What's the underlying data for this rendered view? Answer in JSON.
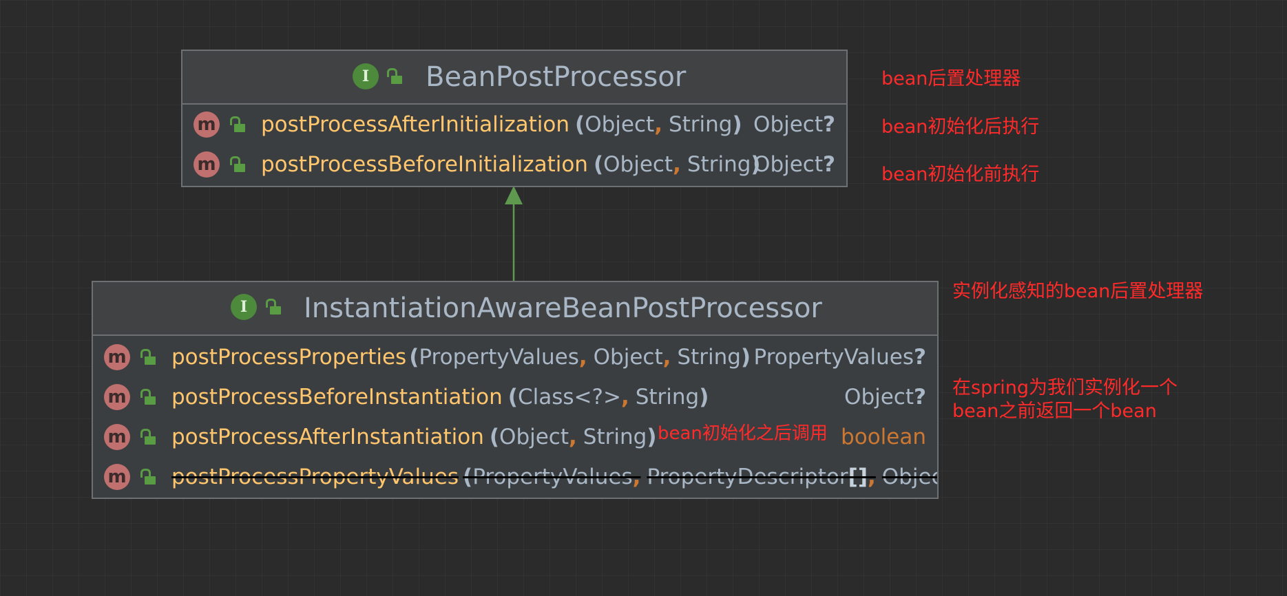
{
  "upper": {
    "badge": "I",
    "name": "BeanPostProcessor",
    "methods": [
      {
        "name": "postProcessAfterInitialization",
        "open": "(",
        "p1": "Object",
        "sep": ",",
        "p2": "String",
        "close": ")",
        "ret": "Object",
        "q": "?"
      },
      {
        "name": "postProcessBeforeInitialization",
        "open": "(",
        "p1": "Object",
        "sep": ",",
        "p2": "String",
        "close": ")",
        "ret": "Object",
        "q": "?"
      }
    ]
  },
  "lower": {
    "badge": "I",
    "name": "InstantiationAwareBeanPostProcessor",
    "methods": [
      {
        "name": "postProcessProperties",
        "open": "(",
        "p1": "PropertyValues",
        "sep1": ",",
        "p2": "Object",
        "sep2": ",",
        "p3": "String",
        "close": ")",
        "ret": "PropertyValues",
        "q": "?"
      },
      {
        "name": "postProcessBeforeInstantiation",
        "open": "(",
        "p1": "Class<?>",
        "sep": ",",
        "p2": "String",
        "close": ")",
        "ret": "Object",
        "q": "?"
      },
      {
        "name": "postProcessAfterInstantiation",
        "open": "(",
        "p1": "Object",
        "sep": ",",
        "p2": "String",
        "close": ")",
        "ret": "boolean"
      },
      {
        "name": "postProcessPropertyValues",
        "open": "(",
        "p1": "PropertyValues",
        "sep1": ",",
        "p2": "PropertyDescriptor",
        "brk": "[]",
        "sep2": ",",
        "p3": "Object",
        "sep3": ","
      }
    ]
  },
  "method_badge": "m",
  "notes": {
    "upper_class": "bean后置处理器",
    "after_init": "bean初始化后执行",
    "before_init": "bean初始化前执行",
    "lower_class": "实例化感知的bean后置处理器",
    "before_inst_line1": "在spring为我们实例化一个",
    "before_inst_line2": "bean之前返回一个bean",
    "after_inst": "bean初始化之后调用"
  },
  "colors": {
    "background": "#2b2b2b",
    "method_name": "#ffc66d",
    "param": "#a9b7c6",
    "punctuation": "#cc7832",
    "note": "#ff2a2a",
    "interface_badge": "#4e8a3c",
    "method_badge": "#c0706e"
  }
}
